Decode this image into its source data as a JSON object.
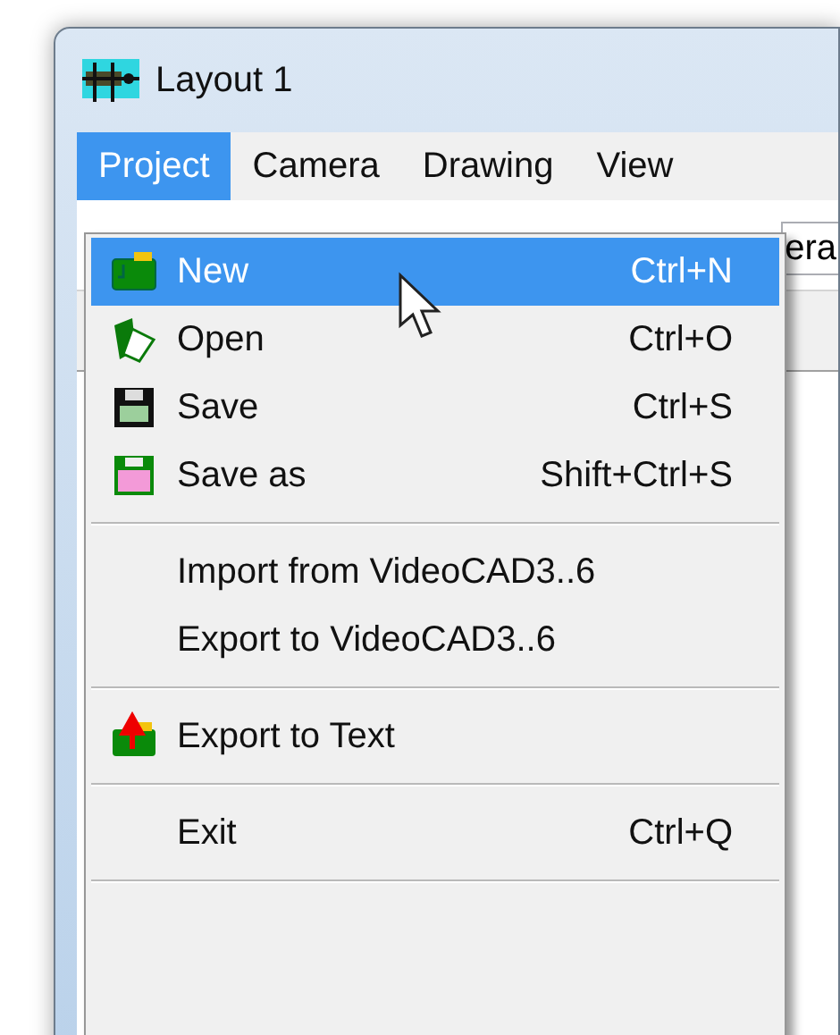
{
  "window": {
    "title": "Layout 1"
  },
  "menu_bar": [
    {
      "label": "Project",
      "selected": true
    },
    {
      "label": "Camera",
      "selected": false
    },
    {
      "label": "Drawing",
      "selected": false
    },
    {
      "label": "View",
      "selected": false
    }
  ],
  "field": {
    "value": "era"
  },
  "menu": [
    {
      "kind": "item",
      "label": "New",
      "shortcut": "Ctrl+N",
      "selected": true
    },
    {
      "kind": "item",
      "label": "Open",
      "shortcut": "Ctrl+O",
      "selected": false
    },
    {
      "kind": "item",
      "label": "Save",
      "shortcut": "Ctrl+S",
      "selected": false
    },
    {
      "kind": "item",
      "label": "Save as",
      "shortcut": "Shift+Ctrl+S",
      "selected": false
    },
    {
      "kind": "separator"
    },
    {
      "kind": "item",
      "label": "Import from VideoCAD3..6",
      "selected": false
    },
    {
      "kind": "item",
      "label": "Export to VideoCAD3..6",
      "selected": false
    },
    {
      "kind": "separator"
    },
    {
      "kind": "item",
      "label": "Export to Text",
      "selected": false
    },
    {
      "kind": "separator"
    },
    {
      "kind": "item",
      "label": "Exit",
      "shortcut": "Ctrl+Q",
      "selected": false
    },
    {
      "kind": "separator"
    }
  ]
}
